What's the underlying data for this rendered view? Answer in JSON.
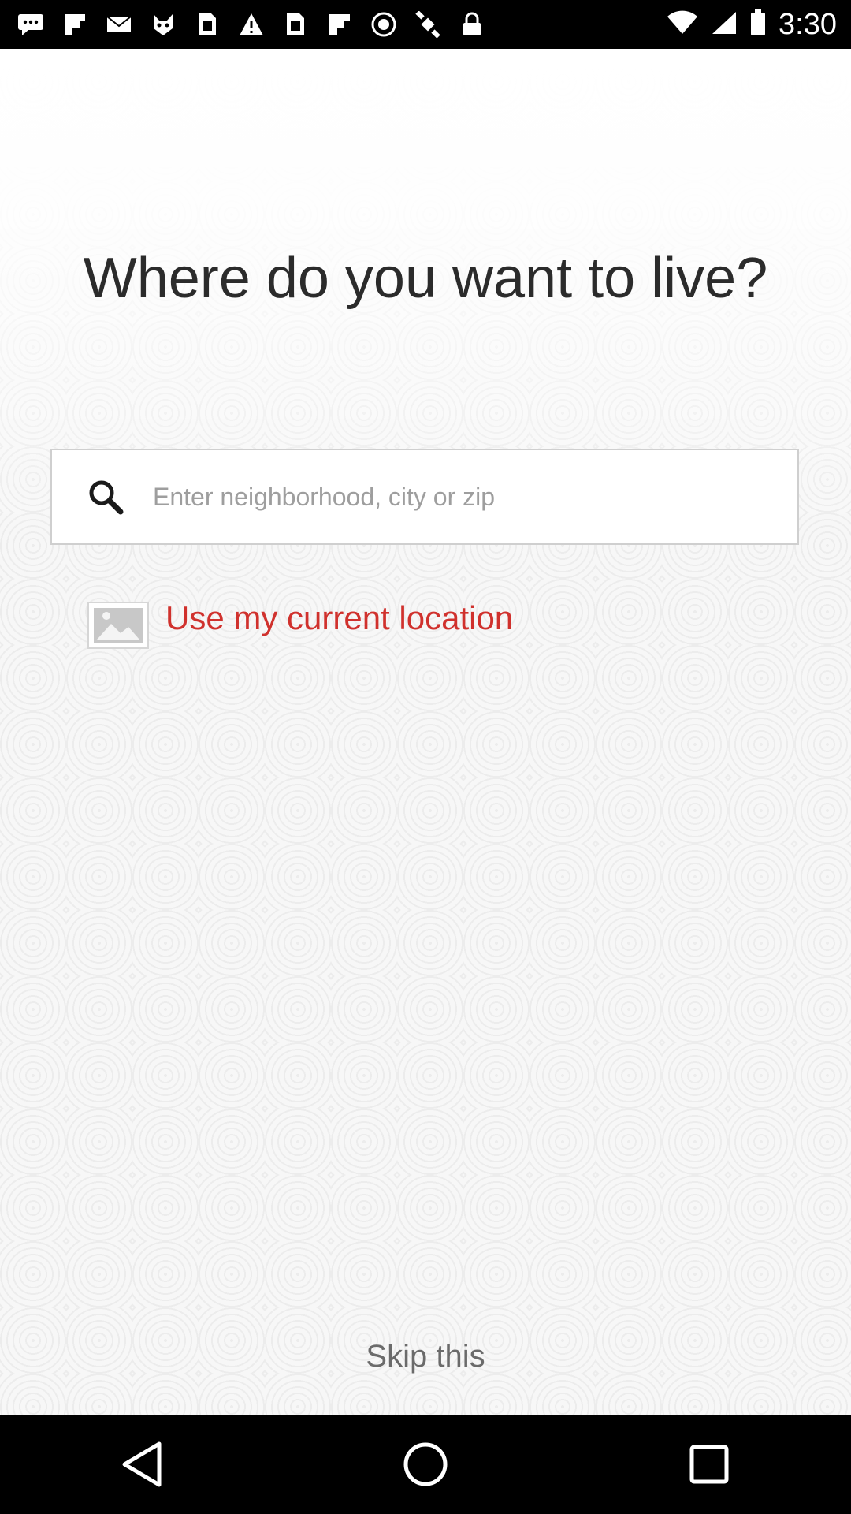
{
  "status_bar": {
    "time": "3:30",
    "icons": [
      "messaging-icon",
      "flipboard-icon",
      "mail-icon",
      "cat-app-icon",
      "sim-toolkit-icon",
      "warning-icon",
      "sim-toolkit-icon",
      "flipboard-icon",
      "do-not-disturb-icon",
      "fake-gps-icon",
      "lock-icon",
      "wifi-icon",
      "signal-icon",
      "battery-icon"
    ]
  },
  "main": {
    "title": "Where do you want to live?",
    "search": {
      "placeholder": "Enter neighborhood, city or zip",
      "value": ""
    },
    "current_location_label": "Use my current location",
    "skip_label": "Skip this"
  },
  "colors": {
    "accent": "#d0312d",
    "title": "#2b2b2b",
    "skip": "#6b6b6b",
    "placeholder": "#9e9e9e"
  },
  "nav_bar": {
    "buttons": [
      "back-icon",
      "home-icon",
      "recents-icon"
    ]
  }
}
